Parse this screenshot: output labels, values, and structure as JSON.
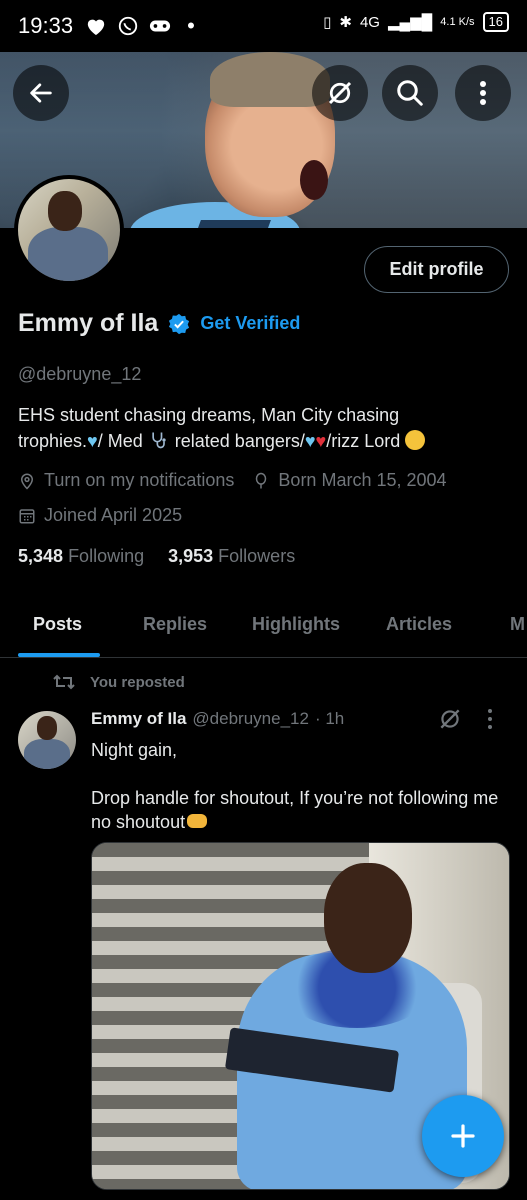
{
  "status_bar": {
    "time": "19:33",
    "network_speed": "4.1 K/s",
    "network_type": "4G",
    "battery": "16"
  },
  "header": {
    "back_icon": "arrow-left-icon",
    "grok_icon": "grok-icon",
    "search_icon": "search-icon",
    "more_icon": "more-vertical-icon"
  },
  "profile": {
    "edit_button": "Edit profile",
    "name": "Emmy of Ila",
    "get_verified": "Get Verified",
    "handle": "@debruyne_12",
    "bio_line1": "EHS student chasing dreams, Man City chasing",
    "bio_line2_a": "trophies.",
    "bio_line2_b": "/ Med ",
    "bio_line2_c": " related bangers/",
    "bio_line2_d": "/rizz Lord ",
    "notifications": "Turn on my notifications",
    "born": "Born March 15, 2004",
    "joined": "Joined April 2025",
    "following_count": "5,348",
    "following_label": "Following",
    "followers_count": "3,953",
    "followers_label": "Followers"
  },
  "tabs": [
    "Posts",
    "Replies",
    "Highlights",
    "Articles",
    "M"
  ],
  "active_tab": "Posts",
  "post": {
    "repost_label": "You reposted",
    "author_name": "Emmy of Ila",
    "author_handle": "@debruyne_12",
    "time": "· 1h",
    "text_line1": "Night gain,",
    "text_line2": "Drop handle for shoutout, If you’re not following me no shoutout"
  },
  "fab_label": "+",
  "colors": {
    "accent": "#1d9bf0",
    "background": "#000000",
    "text_primary": "#e7e9ea",
    "text_secondary": "#71767b"
  }
}
